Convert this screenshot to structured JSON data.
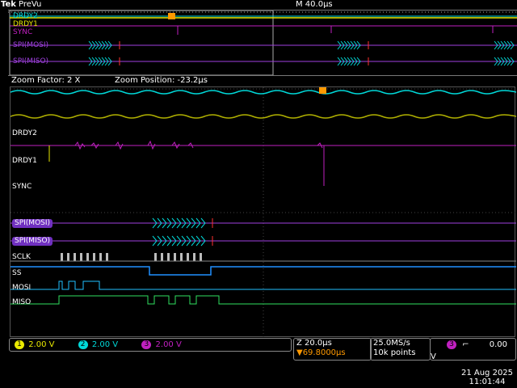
{
  "header": {
    "brand": "Tek",
    "mode": "PreVu",
    "timebase": "M 40.0µs"
  },
  "overview": {
    "labels": {
      "drdy2": "DRDY2",
      "drdy1": "DRDY1",
      "sync": "SYNC",
      "mosi": "SPI(MOSI)",
      "miso": "SPI(MISO)"
    }
  },
  "zoom": {
    "factor_label": "Zoom Factor: 2 X",
    "position_label": "Zoom Position: -23.2µs"
  },
  "channels": {
    "drdy2": "DRDY2",
    "drdy1": "DRDY1",
    "sync": "SYNC",
    "spi_mosi": "SPI(MOSI)",
    "spi_miso": "SPI(MISO)",
    "sclk": "SCLK",
    "ss": "SS",
    "mosi": "MOSI",
    "miso": "MISO"
  },
  "status": {
    "ch1": {
      "num": "1",
      "value": "2.00 V",
      "color": "#e8e800"
    },
    "ch2": {
      "num": "2",
      "value": "2.00 V",
      "color": "#00d8d8"
    },
    "ch3": {
      "num": "3",
      "value": "2.00 V",
      "color": "#c020c0"
    },
    "zoom_time": "Z 20.0µs",
    "trigger_pos": "▼69.8000µs",
    "sample_rate": "25.0MS/s",
    "record_length": "10k points",
    "trigger_channel": "3",
    "trigger_slope": "⌐",
    "trigger_level": "0.00 V",
    "date": "21 Aug 2025",
    "time": "11:01:44"
  }
}
